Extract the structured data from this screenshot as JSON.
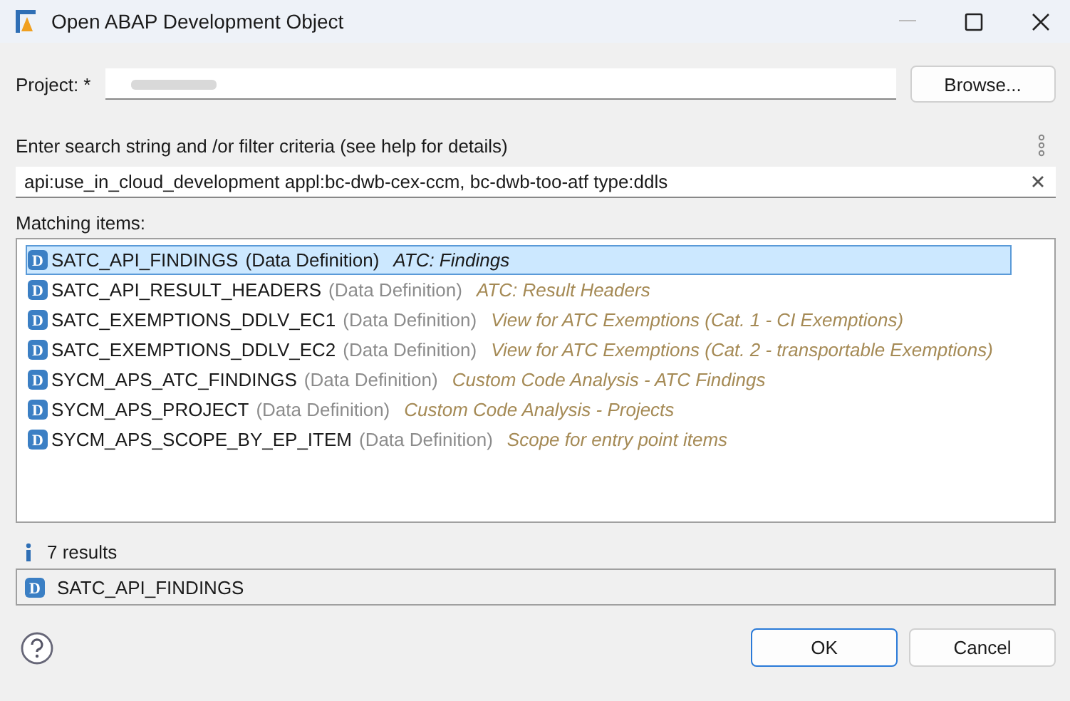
{
  "window": {
    "title": "Open ABAP Development Object"
  },
  "project": {
    "label": "Project: *"
  },
  "browse_button": "Browse...",
  "filter": {
    "label": "Enter search string and /or filter criteria (see help for details)",
    "value": "api:use_in_cloud_development appl:bc-dwb-cex-ccm, bc-dwb-too-atf  type:ddls"
  },
  "matching": {
    "label": "Matching items:",
    "items": [
      {
        "icon_letter": "D",
        "name": "SATC_API_FINDINGS",
        "type": "(Data Definition)",
        "description": "ATC: Findings",
        "selected": true
      },
      {
        "icon_letter": "D",
        "name": "SATC_API_RESULT_HEADERS",
        "type": "(Data Definition)",
        "description": "ATC: Result Headers",
        "selected": false
      },
      {
        "icon_letter": "D",
        "name": "SATC_EXEMPTIONS_DDLV_EC1",
        "type": "(Data Definition)",
        "description": "View for ATC Exemptions (Cat. 1 - CI Exemptions)",
        "selected": false
      },
      {
        "icon_letter": "D",
        "name": "SATC_EXEMPTIONS_DDLV_EC2",
        "type": "(Data Definition)",
        "description": "View for ATC Exemptions (Cat.  2 - transportable Exemptions)",
        "selected": false
      },
      {
        "icon_letter": "D",
        "name": "SYCM_APS_ATC_FINDINGS",
        "type": "(Data Definition)",
        "description": "Custom Code Analysis - ATC Findings",
        "selected": false
      },
      {
        "icon_letter": "D",
        "name": "SYCM_APS_PROJECT",
        "type": "(Data Definition)",
        "description": "Custom Code Analysis - Projects",
        "selected": false
      },
      {
        "icon_letter": "D",
        "name": "SYCM_APS_SCOPE_BY_EP_ITEM",
        "type": "(Data Definition)",
        "description": "Scope for entry point items",
        "selected": false
      }
    ]
  },
  "results": "7 results",
  "selection": {
    "icon_letter": "D",
    "name": "SATC_API_FINDINGS"
  },
  "buttons": [
    "OK",
    "Cancel"
  ]
}
